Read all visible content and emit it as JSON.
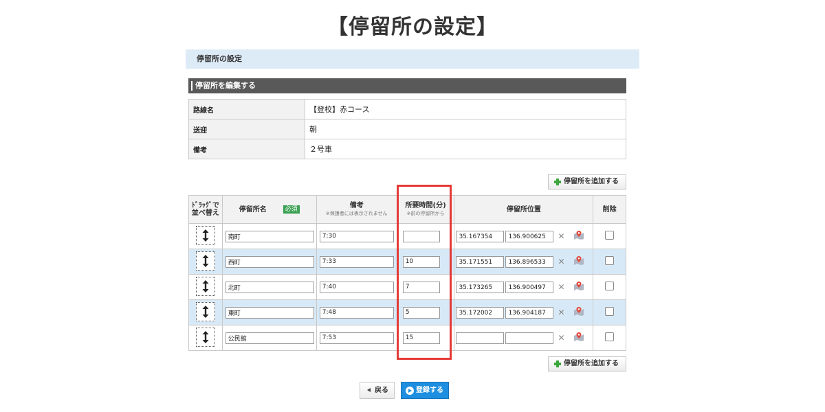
{
  "page_title": "【停留所の設定】",
  "section_title": "停留所の設定",
  "edit_header": "停留所を編集する",
  "info_rows": [
    {
      "label": "路線名",
      "value": "【登校】赤コース"
    },
    {
      "label": "送迎",
      "value": "朝"
    },
    {
      "label": "備考",
      "value": "２号車"
    }
  ],
  "add_stop_label": "停留所を追加する",
  "table_headers": {
    "drag": "ﾄﾞﾗｯｸﾞで\n並べ替え",
    "name": "停留所名",
    "required": "必須",
    "remark": "備考",
    "remark_sub": "※保護者には表示されません",
    "time": "所要時間(分)",
    "time_sub": "※前の停留所から",
    "position": "停留所位置",
    "delete": "削除"
  },
  "stops": [
    {
      "name": "南町",
      "remark": "7:30",
      "time": "",
      "lat": "35.167354",
      "lng": "136.900625"
    },
    {
      "name": "西町",
      "remark": "7:33",
      "time": "10",
      "lat": "35.171551",
      "lng": "136.896533"
    },
    {
      "name": "北町",
      "remark": "7:40",
      "time": "7",
      "lat": "35.173265",
      "lng": "136.900497"
    },
    {
      "name": "東町",
      "remark": "7:48",
      "time": "5",
      "lat": "35.172002",
      "lng": "136.904187"
    },
    {
      "name": "公民館",
      "remark": "7:53",
      "time": "15",
      "lat": "",
      "lng": ""
    }
  ],
  "back_label": "戻る",
  "register_label": "登録する",
  "colors": {
    "highlight": "#e53935",
    "alt_row": "#d7e9f7",
    "required_badge": "#3aa053",
    "register_button": "#1e8fe0"
  }
}
